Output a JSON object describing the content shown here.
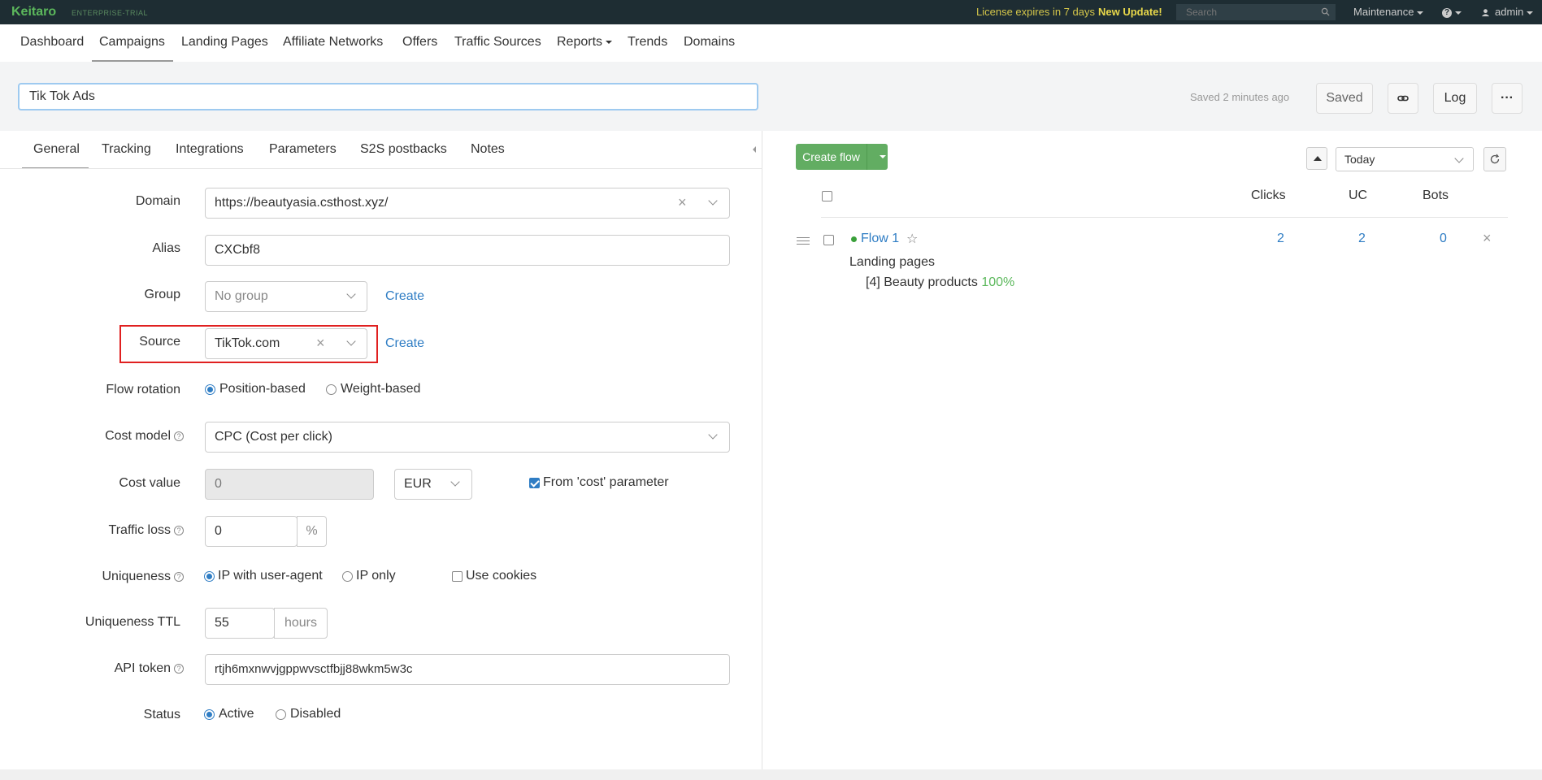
{
  "topbar": {
    "logo": "Keitaro",
    "edition": "ENTERPRISE-TRIAL",
    "license_text": "License expires in 7 days",
    "new_update": "New Update!",
    "search_placeholder": "Search",
    "maintenance": "Maintenance",
    "help": "?",
    "user": "admin"
  },
  "nav": {
    "items": [
      "Dashboard",
      "Campaigns",
      "Landing Pages",
      "Affiliate Networks",
      "Offers",
      "Traffic Sources",
      "Reports",
      "Trends",
      "Domains"
    ],
    "active": "Campaigns"
  },
  "header": {
    "campaign_name": "Tik Tok Ads",
    "saved_status": "Saved 2 minutes ago",
    "saved_button": "Saved",
    "log_button": "Log",
    "more_button": "···"
  },
  "tabs": {
    "items": [
      "General",
      "Tracking",
      "Integrations",
      "Parameters",
      "S2S postbacks",
      "Notes"
    ],
    "active": "General"
  },
  "form": {
    "domain": {
      "label": "Domain",
      "value": "https://beautyasia.csthost.xyz/"
    },
    "alias": {
      "label": "Alias",
      "value": "CXCbf8"
    },
    "group": {
      "label": "Group",
      "value": "No group",
      "create": "Create"
    },
    "source": {
      "label": "Source",
      "value": "TikTok.com",
      "create": "Create"
    },
    "flow_rotation": {
      "label": "Flow rotation",
      "options": [
        "Position-based",
        "Weight-based"
      ],
      "selected": "Position-based"
    },
    "cost_model": {
      "label": "Cost model",
      "value": "CPC (Cost per click)"
    },
    "cost_value": {
      "label": "Cost value",
      "value": "0",
      "currency": "EUR",
      "from_cost_label": "From 'cost' parameter",
      "from_cost_checked": true
    },
    "traffic_loss": {
      "label": "Traffic loss",
      "value": "0",
      "unit": "%"
    },
    "uniqueness": {
      "label": "Uniqueness",
      "options": [
        "IP with user-agent",
        "IP only"
      ],
      "selected": "IP with user-agent",
      "use_cookies_label": "Use cookies",
      "use_cookies_checked": false
    },
    "uniqueness_ttl": {
      "label": "Uniqueness TTL",
      "value": "55",
      "unit": "hours"
    },
    "api_token": {
      "label": "API token",
      "value": "rtjh6mxnwvjgppwvsctfbjj88wkm5w3c"
    },
    "status": {
      "label": "Status",
      "options": [
        "Active",
        "Disabled"
      ],
      "selected": "Active"
    },
    "help_icon": "?"
  },
  "flows": {
    "create_button": "Create flow",
    "date_range": "Today",
    "columns": [
      "Clicks",
      "UC",
      "Bots"
    ],
    "rows": [
      {
        "name": "Flow 1",
        "clicks": "2",
        "uc": "2",
        "bots": "0",
        "landing_title": "Landing pages",
        "landing_item": "[4] Beauty products",
        "landing_pct": "100%"
      }
    ]
  },
  "colors": {
    "topbar_bg": "#1e2d33",
    "accent_link": "#2f7dc4",
    "create_green": "#62ad62",
    "highlight_red": "#e02020"
  },
  "icons": [
    "search-icon",
    "caret-down-icon",
    "user-icon",
    "help-icon",
    "link-icon",
    "more-icon",
    "chevron-down-icon",
    "clear-icon",
    "star-icon",
    "drag-handle-icon",
    "delete-icon",
    "refresh-icon",
    "sort-up-icon",
    "collapse-left-icon"
  ]
}
